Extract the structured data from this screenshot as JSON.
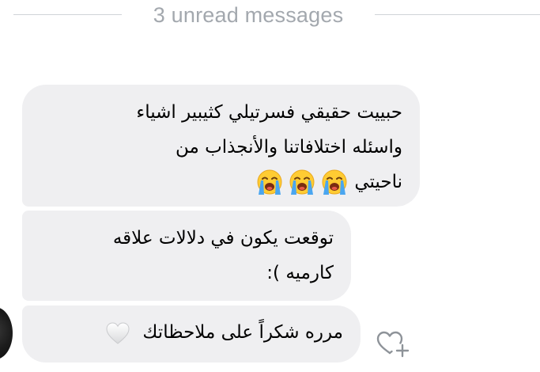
{
  "divider": {
    "label": "3 unread messages"
  },
  "messages": [
    {
      "lines": [
        "حبييت حقيقي فسرتيلي كثيبير اشياء",
        "واسئله اختلافاتنا والأنجذاب من",
        "ناحيتي"
      ],
      "emojis": [
        "loudly-crying-face",
        "loudly-crying-face",
        "loudly-crying-face"
      ]
    },
    {
      "lines": [
        "توقعت يكون في دلالات علاقه",
        "كارميه ):"
      ]
    },
    {
      "lines": [
        "مرره شكراً على ملاحظاتك"
      ],
      "emojis": [
        "white-heart"
      ]
    }
  ],
  "actions": {
    "react_icon": "heart-plus-icon"
  },
  "colors": {
    "bubble_background": "#efeff1",
    "divider_text": "#a3a8ae",
    "divider_line": "#cfd3d8",
    "icon_stroke": "#8e9399"
  }
}
